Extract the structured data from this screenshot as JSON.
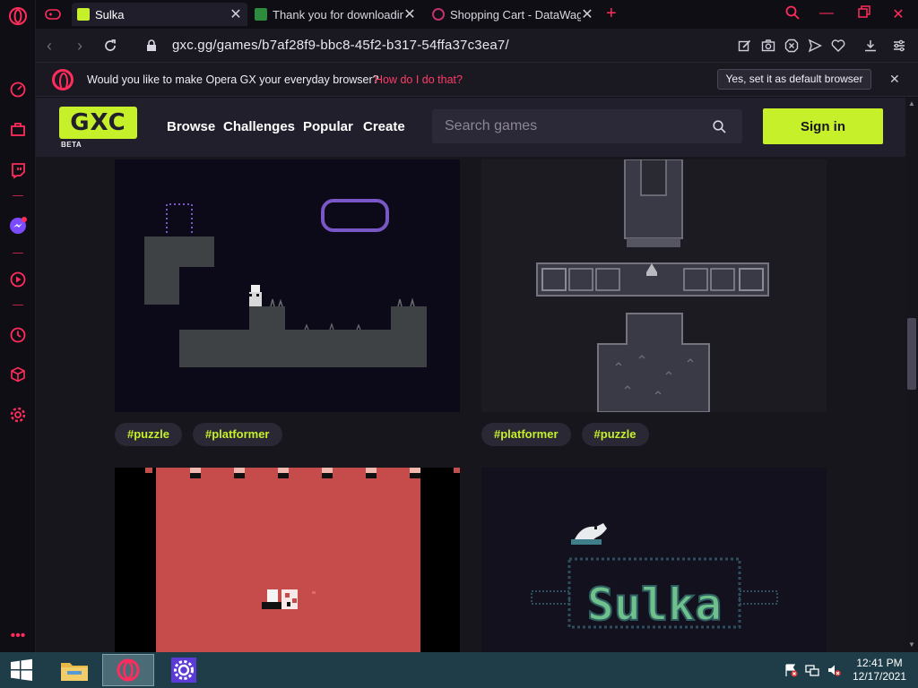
{
  "tabs": [
    {
      "title": "Sulka",
      "favicon_color": "#c6f02a",
      "active": true
    },
    {
      "title": "Thank you for downloading",
      "favicon_color": "#2e8a3c",
      "active": false
    },
    {
      "title": "Shopping Cart - DataWago",
      "favicon_color": "#c0326b",
      "active": false
    }
  ],
  "address": {
    "url": "gxc.gg/games/b7af28f9-bbc8-45f2-b317-54ffa37c3ea7/"
  },
  "infobar": {
    "question": "Would you like to make Opera GX your everyday browser?",
    "how_link": "How do I do that?",
    "set_default": "Yes, set it as default browser"
  },
  "site": {
    "logo_text": "GXC",
    "beta": "BETA",
    "nav": [
      "Browse",
      "Challenges",
      "Popular",
      "Create"
    ],
    "search_placeholder": "Search games",
    "signin": "Sign in"
  },
  "cards": [
    {
      "tags": [
        "#puzzle",
        "#platformer"
      ]
    },
    {
      "tags": [
        "#platformer",
        "#puzzle"
      ]
    },
    {
      "title_art": "Sulka"
    }
  ],
  "clock": {
    "time": "12:41 PM",
    "date": "12/17/2021"
  },
  "colors": {
    "accent": "#ff2c5c",
    "brand": "#c6f02a",
    "taskbar": "#1e3d48"
  }
}
